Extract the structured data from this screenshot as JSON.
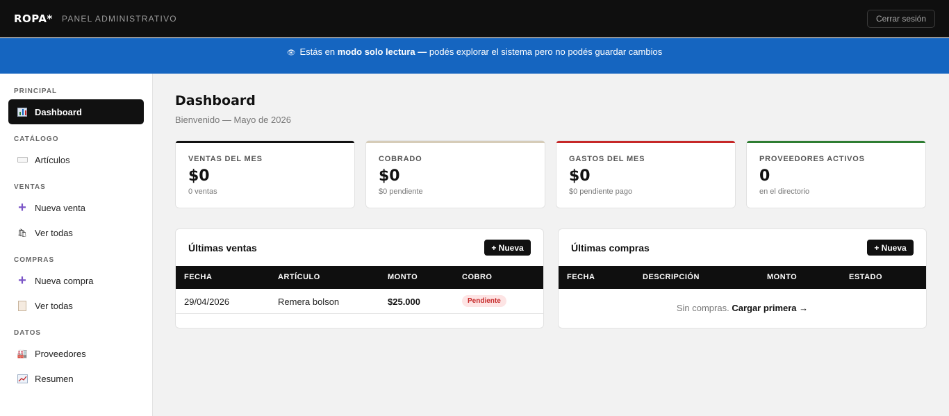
{
  "header": {
    "brand": "ROPA*",
    "panel_title": "PANEL ADMINISTRATIVO",
    "logout_label": "Cerrar sesión"
  },
  "banner": {
    "icon": "eye-icon",
    "prefix": "Estás en ",
    "bold": "modo solo lectura —",
    "suffix": " podés explorar el sistema pero no podés guardar cambios"
  },
  "sidebar": {
    "sections": {
      "principal": "PRINCIPAL",
      "catalogo": "CATÁLOGO",
      "ventas": "VENTAS",
      "compras": "COMPRAS",
      "datos": "DATOS"
    },
    "items": {
      "dashboard": "Dashboard",
      "articulos": "Artículos",
      "nueva_venta": "Nueva venta",
      "ver_ventas": "Ver todas",
      "nueva_compra": "Nueva compra",
      "ver_compras": "Ver todas",
      "proveedores": "Proveedores",
      "resumen": "Resumen"
    }
  },
  "main": {
    "title": "Dashboard",
    "subtitle": "Bienvenido — Mayo de 2026",
    "stats": [
      {
        "label": "VENTAS DEL MES",
        "value": "$0",
        "sub": "0 ventas",
        "color": "#111111"
      },
      {
        "label": "COBRADO",
        "value": "$0",
        "sub": "$0 pendiente",
        "color": "#d6ccb8"
      },
      {
        "label": "GASTOS DEL MES",
        "value": "$0",
        "sub": "$0 pendiente pago",
        "color": "#c62828"
      },
      {
        "label": "PROVEEDORES ACTIVOS",
        "value": "0",
        "sub": "en el directorio",
        "color": "#2e7d32"
      }
    ],
    "ventas": {
      "title": "Últimas ventas",
      "new_label": "+ Nueva",
      "columns": [
        "FECHA",
        "ARTÍCULO",
        "MONTO",
        "COBRO"
      ],
      "rows": [
        {
          "fecha": "29/04/2026",
          "articulo": "Remera bolson",
          "monto": "$25.000",
          "cobro": "Pendiente"
        }
      ]
    },
    "compras": {
      "title": "Últimas compras",
      "new_label": "+ Nueva",
      "columns": [
        "FECHA",
        "DESCRIPCIÓN",
        "MONTO",
        "ESTADO"
      ],
      "empty_text": "Sin compras. ",
      "empty_link": "Cargar primera →"
    }
  }
}
